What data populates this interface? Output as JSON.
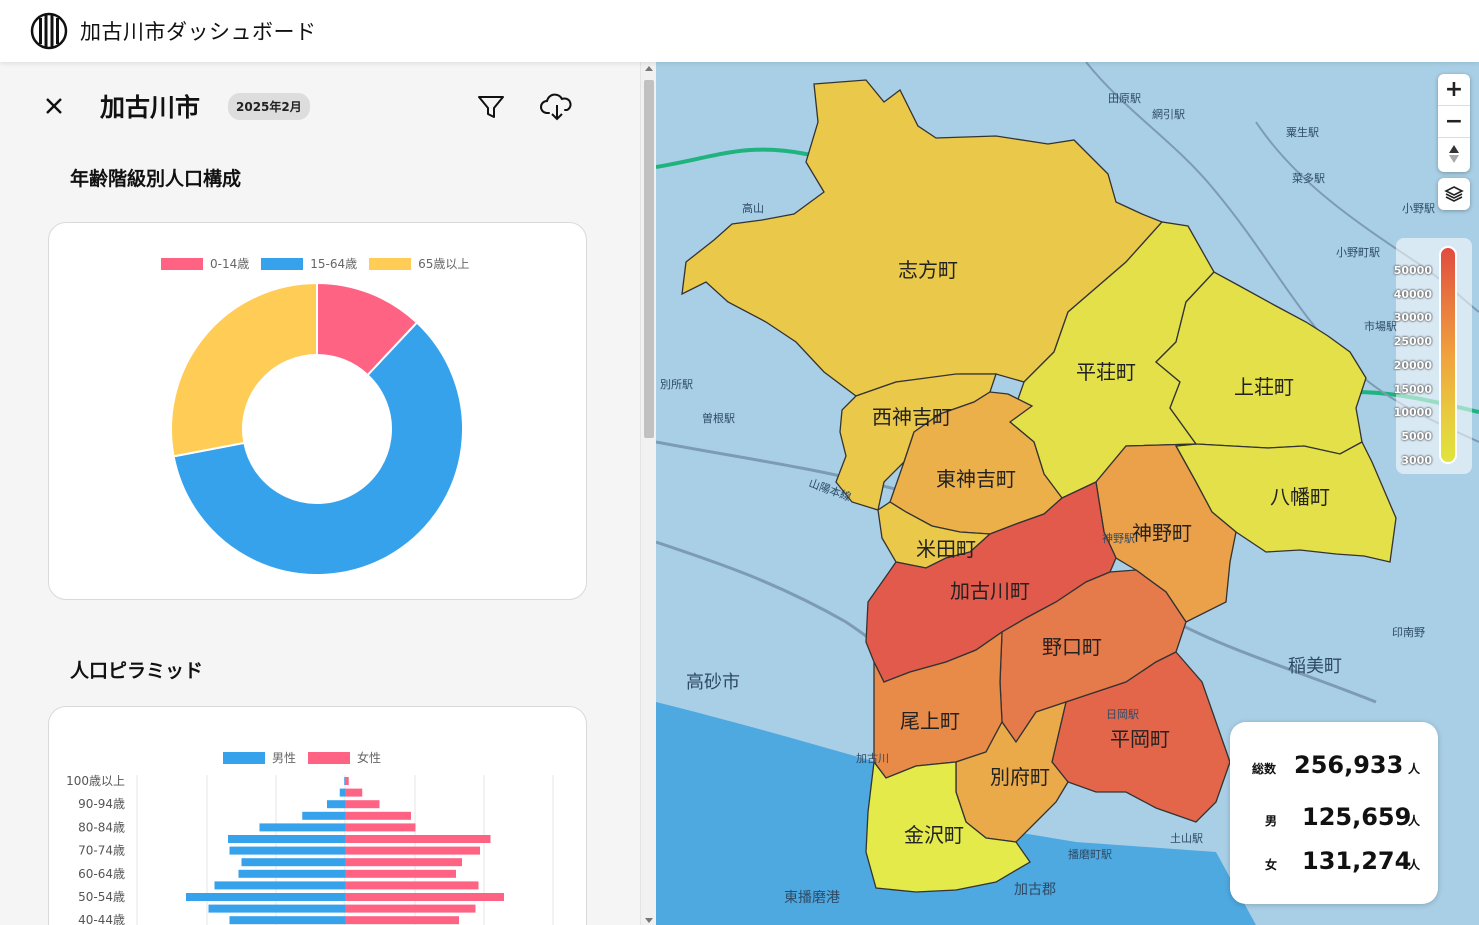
{
  "app": {
    "title": "加古川市ダッシュボード",
    "logo_icon": "logo-icon"
  },
  "panel": {
    "city_name": "加古川市",
    "date_badge": "2025年2月",
    "close_icon": "close-icon",
    "filter_icon": "filter-icon",
    "download_icon": "cloud-download-icon"
  },
  "donut_section": {
    "title": "年齢階級別人口構成",
    "legend": [
      {
        "label": "0-14歳",
        "color": "#ff6384"
      },
      {
        "label": "15-64歳",
        "color": "#36a2eb"
      },
      {
        "label": "65歳以上",
        "color": "#ffcd56"
      }
    ],
    "chart_data": {
      "type": "pie",
      "categories": [
        "0-14歳",
        "15-64歳",
        "65歳以上"
      ],
      "values": [
        12,
        60,
        28
      ],
      "colors": [
        "#ff6384",
        "#36a2eb",
        "#ffcd56"
      ]
    }
  },
  "pyramid_section": {
    "title": "人口ピラミッド",
    "legend": [
      {
        "label": "男性",
        "color": "#36a2eb"
      },
      {
        "label": "女性",
        "color": "#ff6384"
      }
    ],
    "chart_data": {
      "type": "bar",
      "orientation": "horizontal",
      "categories": [
        "100歳以上",
        "95-99歳",
        "90-94歳",
        "85-89歳",
        "80-84歳",
        "75-79歳",
        "70-74歳",
        "65-69歳",
        "60-64歳",
        "55-59歳",
        "50-54歳",
        "45-49歳",
        "40-44歳"
      ],
      "tick_labels_shown": [
        "100歳以上",
        "90-94歳",
        "80-84歳",
        "70-74歳",
        "60-64歳",
        "50-54歳",
        "40-44歳"
      ],
      "series": [
        {
          "name": "男性",
          "values": [
            50,
            350,
            1200,
            2850,
            5700,
            7800,
            7700,
            6900,
            7100,
            8700,
            10600,
            9100,
            7700
          ]
        },
        {
          "name": "女性",
          "values": [
            250,
            1150,
            2300,
            4400,
            4700,
            9700,
            9000,
            7800,
            7400,
            8900,
            10600,
            8700,
            7600
          ]
        }
      ]
    }
  },
  "map": {
    "districts": [
      {
        "name": "志方町",
        "color": "#e9c84a"
      },
      {
        "name": "平荘町",
        "color": "#e3e04a"
      },
      {
        "name": "上荘町",
        "color": "#e3e04a"
      },
      {
        "name": "西神吉町",
        "color": "#e9c84a"
      },
      {
        "name": "東神吉町",
        "color": "#ebb04a"
      },
      {
        "name": "八幡町",
        "color": "#e3e04a"
      },
      {
        "name": "米田町",
        "color": "#e9c84a"
      },
      {
        "name": "神野町",
        "color": "#eba04a"
      },
      {
        "name": "加古川町",
        "color": "#e25a4c"
      },
      {
        "name": "野口町",
        "color": "#e57a4a"
      },
      {
        "name": "尾上町",
        "color": "#e88a48"
      },
      {
        "name": "平岡町",
        "color": "#e4664a"
      },
      {
        "name": "別府町",
        "color": "#ebaa4a"
      },
      {
        "name": "金沢町",
        "color": "#e3ea4a"
      }
    ],
    "place_labels": [
      "高砂市",
      "稲美町",
      "東播磨港",
      "加古郡",
      "高山",
      "粟生駅",
      "菜多駅",
      "小野駅",
      "小野町駅",
      "市場駅",
      "山陽本線",
      "播磨町駅",
      "土山駅",
      "加古川",
      "印南野",
      "日岡駅",
      "田原駅",
      "網引駅",
      "別所駅",
      "曽根駅",
      "神野駅"
    ],
    "controls": {
      "zoom_in": "+",
      "zoom_out": "−",
      "compass_icon": "compass-icon",
      "layers_icon": "layers-icon"
    },
    "scale_labels": [
      "50000",
      "40000",
      "30000",
      "25000",
      "20000",
      "15000",
      "10000",
      "5000",
      "3000"
    ]
  },
  "stats": {
    "total_label": "総数",
    "total_value": "256,933",
    "total_unit": "人",
    "male_label": "男",
    "male_value": "125,659",
    "male_unit": "人",
    "female_label": "女",
    "female_value": "131,274",
    "female_unit": "人"
  }
}
